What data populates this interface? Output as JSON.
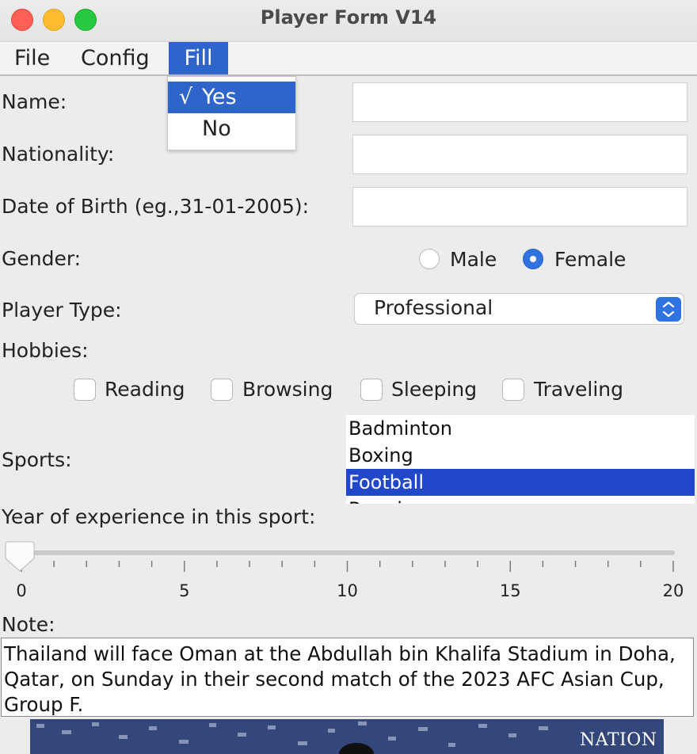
{
  "window": {
    "title": "Player Form V14"
  },
  "menubar": {
    "items": [
      {
        "label": "File"
      },
      {
        "label": "Config"
      },
      {
        "label": "Fill",
        "active": true
      }
    ]
  },
  "fill_menu": {
    "items": [
      {
        "label": "Yes",
        "checked": true,
        "check_mark": "√"
      },
      {
        "label": "No",
        "checked": false
      }
    ]
  },
  "form": {
    "name_label": "Name:",
    "name_value": "",
    "nationality_label": "Nationality:",
    "nationality_value": "",
    "dob_label": "Date of Birth (eg.,31-01-2005):",
    "dob_value": "",
    "gender_label": "Gender:",
    "gender_options": [
      {
        "label": "Male",
        "selected": false
      },
      {
        "label": "Female",
        "selected": true
      }
    ],
    "player_type_label": "Player Type:",
    "player_type_value": "Professional",
    "hobbies_label": "Hobbies:",
    "hobbies": [
      {
        "label": "Reading",
        "checked": false
      },
      {
        "label": "Browsing",
        "checked": false
      },
      {
        "label": "Sleeping",
        "checked": false
      },
      {
        "label": "Traveling",
        "checked": false
      }
    ],
    "sports_label": "Sports:",
    "sports_list": [
      {
        "label": "Badminton",
        "selected": false
      },
      {
        "label": "Boxing",
        "selected": false
      },
      {
        "label": "Football",
        "selected": true
      },
      {
        "label": "Running",
        "selected": false
      }
    ],
    "experience_label": "Year of experience in this sport:",
    "experience_slider": {
      "min": 0,
      "max": 20,
      "value": 0,
      "major_labels": [
        "0",
        "5",
        "10",
        "15",
        "20"
      ]
    },
    "note_label": "Note:",
    "note_text": "Thailand will face Oman at the Abdullah bin Khalifa Stadium in Doha, Qatar, on Sunday in their second match of the 2023 AFC Asian Cup, Group F."
  },
  "photo": {
    "logo_text": "NATION"
  },
  "colors": {
    "accent": "#2f65ca",
    "list_selection": "#2148c9",
    "window_bg": "#ececec"
  }
}
